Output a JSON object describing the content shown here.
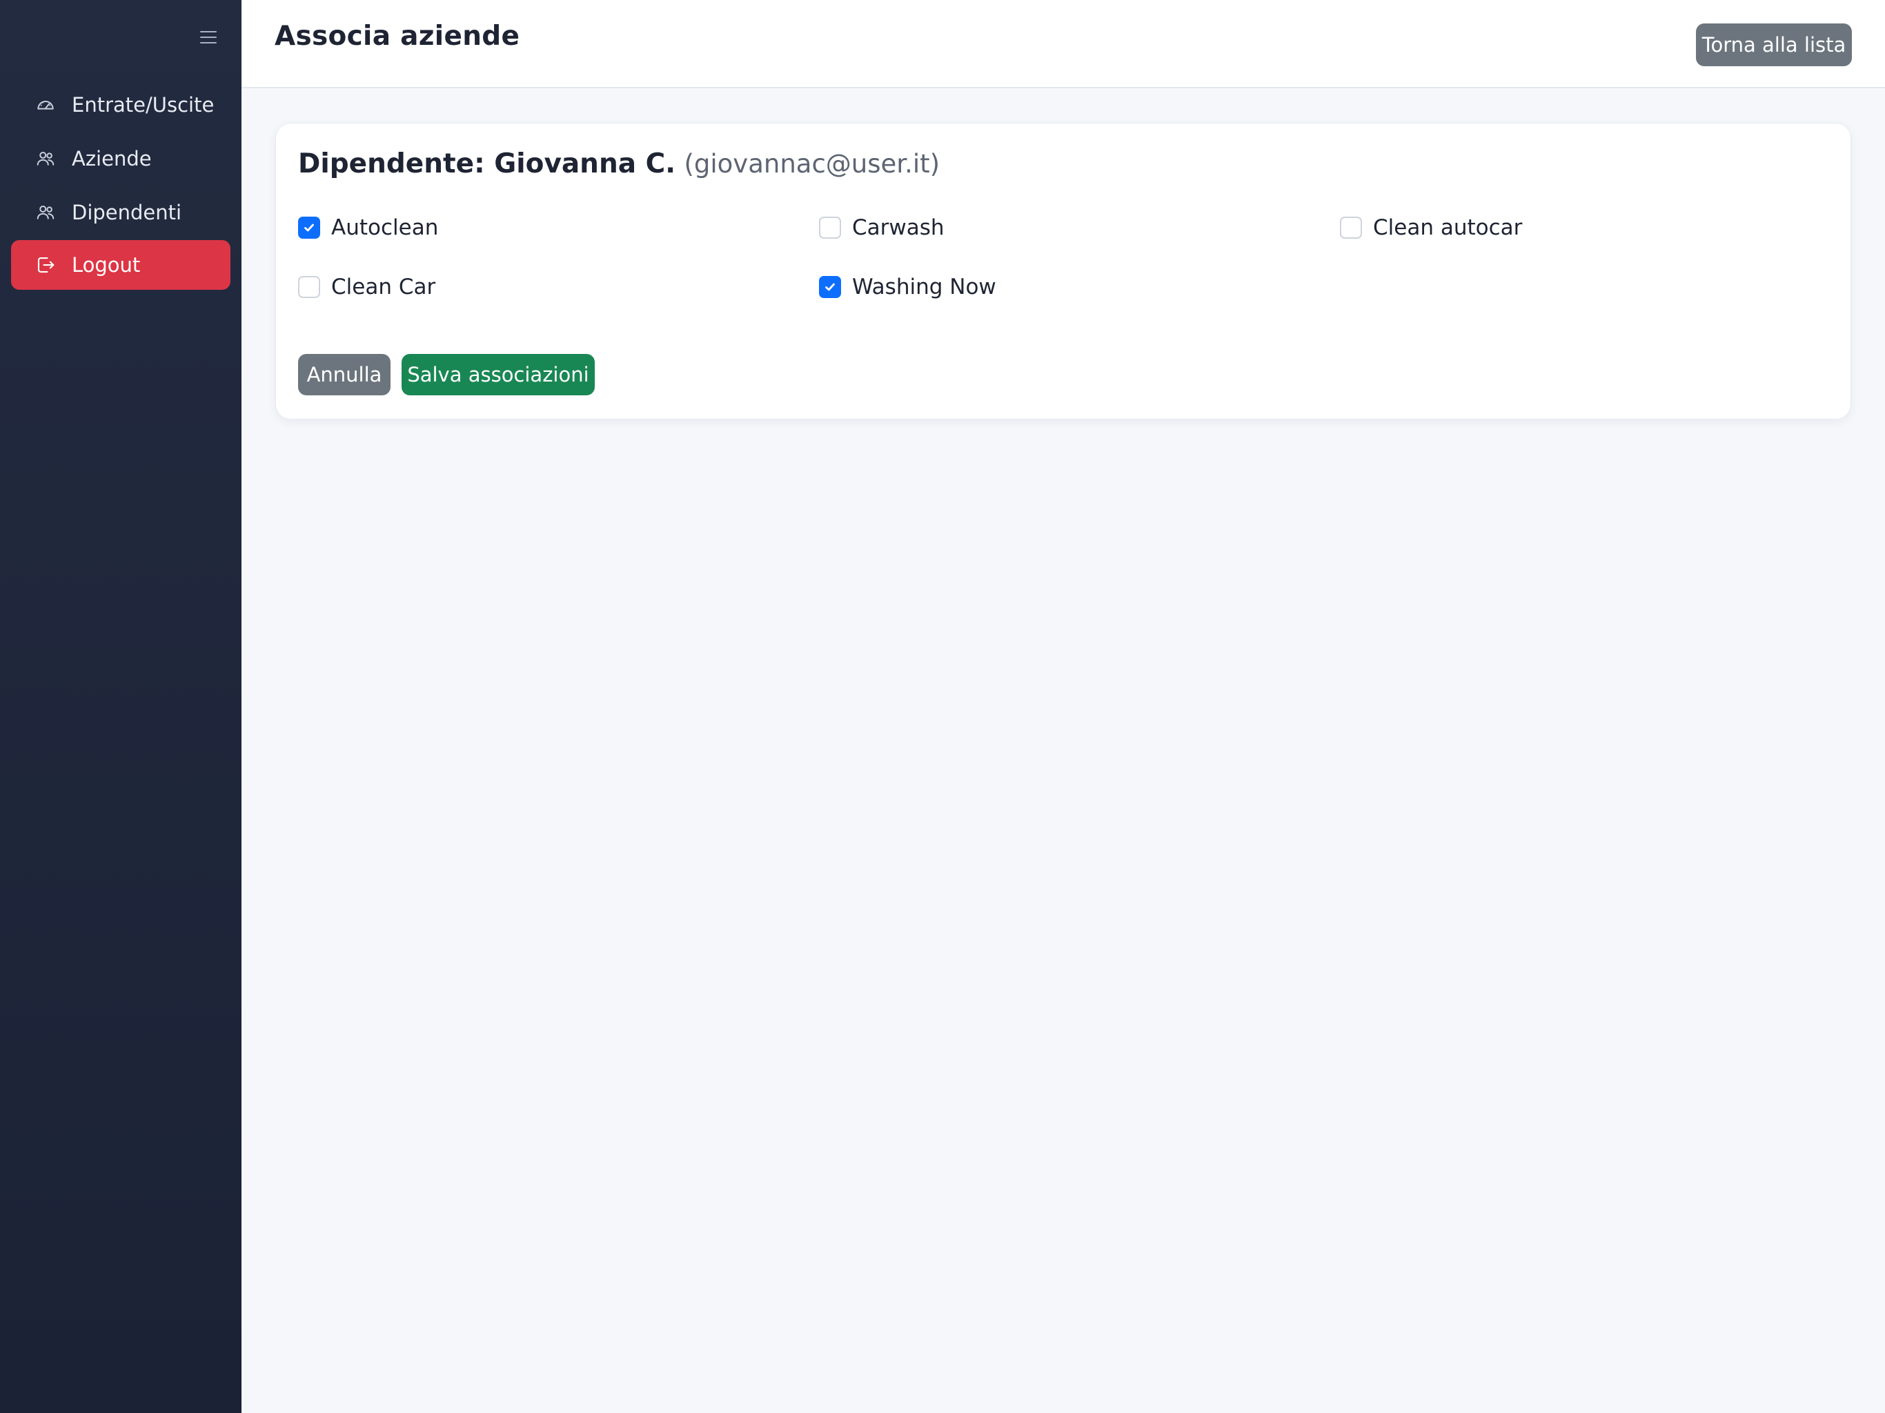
{
  "sidebar": {
    "items": [
      {
        "label": "Entrate/Uscite",
        "icon": "gauge-icon"
      },
      {
        "label": "Aziende",
        "icon": "users-icon"
      },
      {
        "label": "Dipendenti",
        "icon": "users-icon"
      },
      {
        "label": "Logout",
        "icon": "logout-icon"
      }
    ],
    "logout_color": "#dc3545"
  },
  "header": {
    "title": "Associa aziende",
    "back_label": "Torna alla lista"
  },
  "card": {
    "title_label": "Dipendente: Giovanna C.",
    "email": "(giovannac@user.it)",
    "companies": [
      {
        "name": "Autoclean",
        "checked": true
      },
      {
        "name": "Carwash",
        "checked": false
      },
      {
        "name": "Clean autocar",
        "checked": false
      },
      {
        "name": "Clean Car",
        "checked": false
      },
      {
        "name": "Washing Now",
        "checked": true
      }
    ],
    "cancel_label": "Annulla",
    "save_label": "Salva associazioni"
  },
  "colors": {
    "primary": "#0d6efd",
    "success": "#198754",
    "secondary": "#6c757d",
    "sidebar_bg": "#1e253a"
  }
}
